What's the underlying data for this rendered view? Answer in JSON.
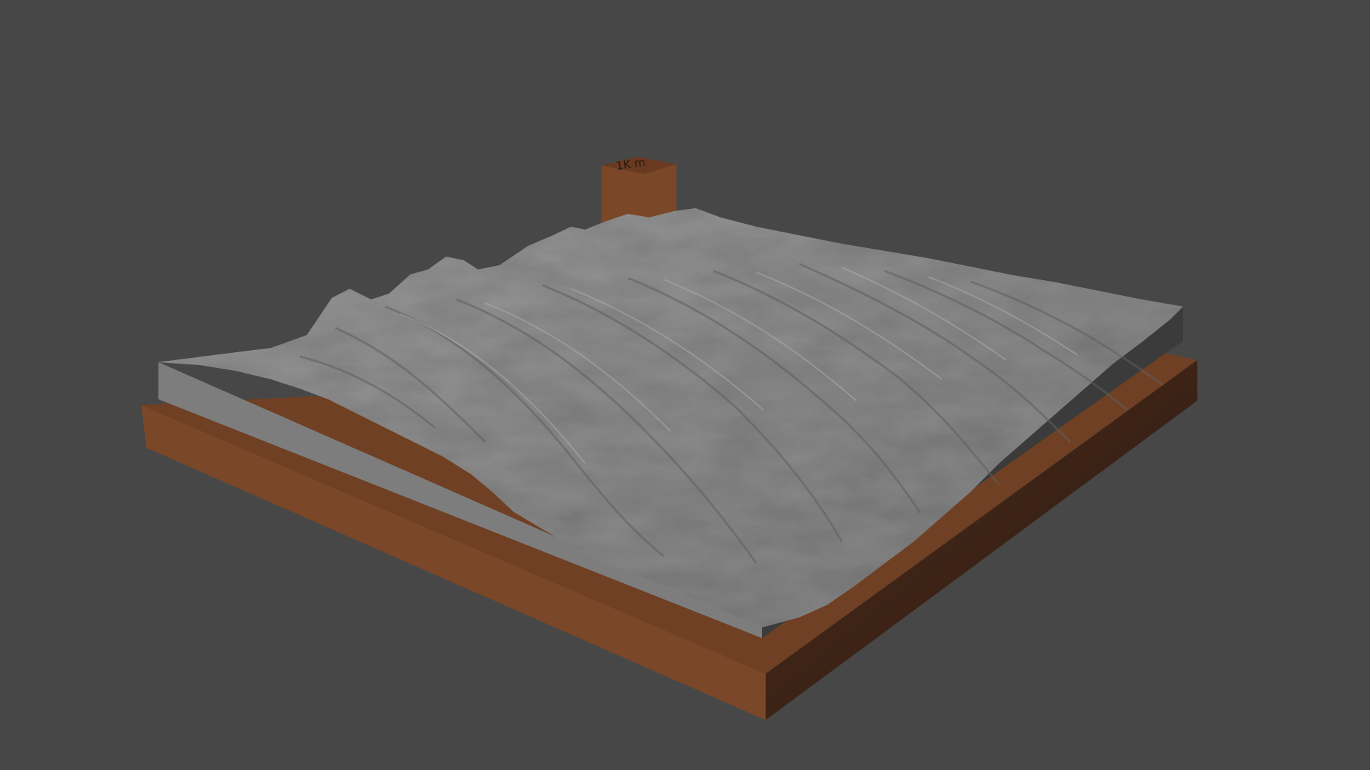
{
  "scene": {
    "background_color": "#474747",
    "objects": [
      {
        "name": "terrain-relief-model",
        "description_color": "#8e8e8e"
      },
      {
        "name": "wooden-base-plate",
        "description_color": "#7a4728"
      },
      {
        "name": "label-block",
        "description_color": "#7a4728"
      }
    ]
  },
  "label_block": {
    "text": "1K m",
    "color": "#7a4728"
  },
  "colors": {
    "terrain_top": "#8e8e8e",
    "terrain_front_side": "#7e7e7e",
    "terrain_right_side": "#3c3c3c",
    "base_top": "#7a4728",
    "base_front": "#7a4728",
    "base_right": "#3b2418",
    "block_front": "#7a4728",
    "block_side": "#3a2215"
  }
}
